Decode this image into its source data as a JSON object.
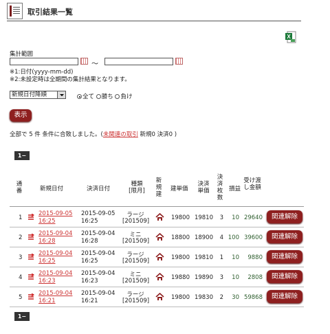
{
  "header": {
    "title": "取引結果一覧"
  },
  "form": {
    "range_label": "集計範囲",
    "date_from": "",
    "date_to": "",
    "tilde": "～",
    "note1": "※1:日付(yyyy-mm-dd)",
    "note2": "※2:未設定時は全期間の集計結果となります。",
    "sort_selected": "新規日付降順",
    "radio_all": "全て",
    "radio_win": "勝ち",
    "radio_loss": "負け",
    "show_button": "表示"
  },
  "summary": {
    "prefix": "全部で 5 件 条件に合致しました。(",
    "link": "未関連の取引",
    "suffix": " 新規0 決済0 )"
  },
  "pager": "1−",
  "columns": {
    "no": "通番",
    "new_date": "新規日付",
    "settle_date": "決済日付",
    "kind": "種類\n[限月]",
    "new_build": "新規建",
    "build_price": "建単価",
    "settle_price": "決済単価",
    "settle_qty": "決済枚数",
    "pl": "損益",
    "delivery": "受け渡し金額"
  },
  "rows": [
    {
      "no": "1",
      "new_date": "2015-09-05",
      "new_time": "16:25",
      "settle_date": "2015-09-05",
      "settle_time": "16:25",
      "kind": "ラージ",
      "month": "[201509]",
      "build_price": "19800",
      "settle_price": "19810",
      "qty": "3",
      "pl": "10",
      "amount": "29640",
      "action": "関連解除"
    },
    {
      "no": "2",
      "new_date": "2015-09-04",
      "new_time": "16:28",
      "settle_date": "2015-09-04",
      "settle_time": "16:28",
      "kind": "ミニ",
      "month": "[201509]",
      "build_price": "18800",
      "settle_price": "18900",
      "qty": "4",
      "pl": "100",
      "amount": "39600",
      "action": "関連解除"
    },
    {
      "no": "3",
      "new_date": "2015-09-04",
      "new_time": "16:25",
      "settle_date": "2015-09-04",
      "settle_time": "16:25",
      "kind": "ラージ",
      "month": "[201509]",
      "build_price": "19800",
      "settle_price": "19810",
      "qty": "1",
      "pl": "10",
      "amount": "9880",
      "action": "関連解除"
    },
    {
      "no": "4",
      "new_date": "2015-09-04",
      "new_time": "16:23",
      "settle_date": "2015-09-04",
      "settle_time": "16:23",
      "kind": "ミニ",
      "month": "[201509]",
      "build_price": "19880",
      "settle_price": "19890",
      "qty": "3",
      "pl": "10",
      "amount": "2808",
      "action": "関連解除"
    },
    {
      "no": "5",
      "new_date": "2015-09-04",
      "new_time": "16:21",
      "settle_date": "2015-09-04",
      "settle_time": "16:21",
      "kind": "ラージ",
      "month": "[201509]",
      "build_price": "19800",
      "settle_price": "19830",
      "qty": "2",
      "pl": "30",
      "amount": "59868",
      "action": "関連解除"
    }
  ],
  "colors": {
    "accent": "#8e1f1f",
    "link": "#cc3333",
    "pager": "#333333"
  }
}
